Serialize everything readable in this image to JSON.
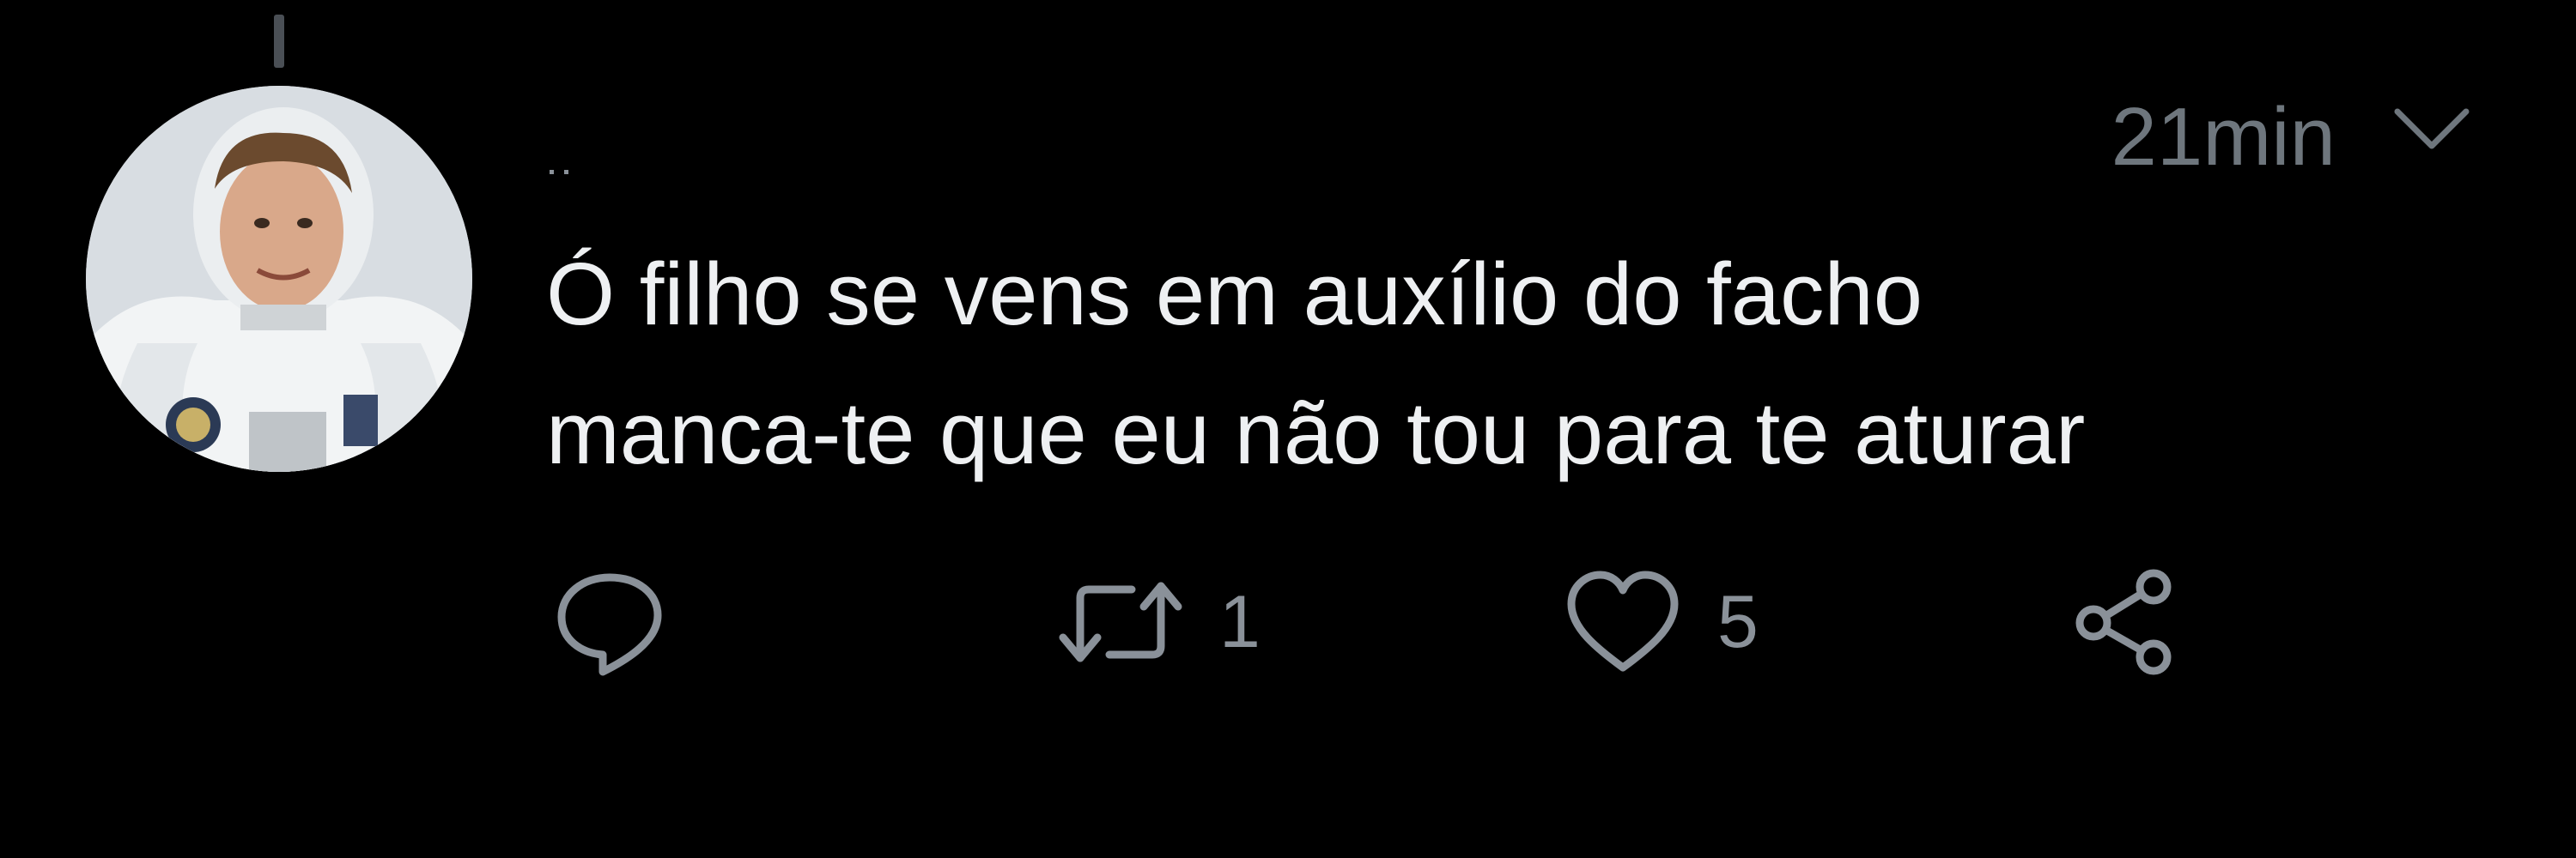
{
  "tweet": {
    "author_name": "",
    "timestamp": "21min",
    "text_lines": [
      "Ó filho se vens em auxílio do facho",
      "manca-te que eu não tou para te aturar"
    ]
  },
  "actions": {
    "reply": {
      "icon": "reply-icon",
      "count": ""
    },
    "retweet": {
      "icon": "retweet-icon",
      "count": "1"
    },
    "like": {
      "icon": "heart-icon",
      "count": "5"
    },
    "share": {
      "icon": "share-icon",
      "count": ""
    }
  },
  "colors": {
    "background": "#000000",
    "text": "#eef0f2",
    "muted": "#6e767d",
    "icon": "#8a9199"
  }
}
